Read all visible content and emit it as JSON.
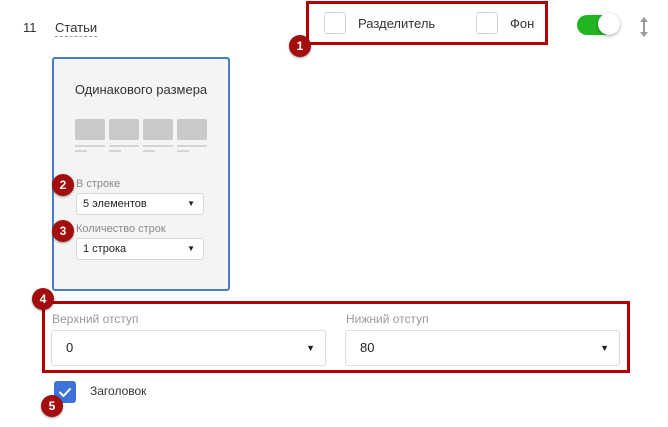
{
  "row": {
    "number": "11",
    "title": "Статьи"
  },
  "options": {
    "divider_label": "Разделитель",
    "background_label": "Фон"
  },
  "toggle": {
    "state": "on",
    "color": "#22b422"
  },
  "layout": {
    "title": "Одинакового размера",
    "per_row": {
      "label": "В строке",
      "value": "5 элементов"
    },
    "rows": {
      "label": "Количество строк",
      "value": "1 строка"
    }
  },
  "spacing": {
    "top": {
      "label": "Верхний отступ",
      "value": "0"
    },
    "bottom": {
      "label": "Нижний отступ",
      "value": "80"
    }
  },
  "heading": {
    "label": "Заголовок",
    "checked": true
  },
  "badges": [
    "1",
    "2",
    "3",
    "4",
    "5"
  ],
  "colors": {
    "highlight": "#b00000",
    "badge": "#a30d0d",
    "accent": "#3d72d9",
    "card_border": "#4a7cc9"
  }
}
